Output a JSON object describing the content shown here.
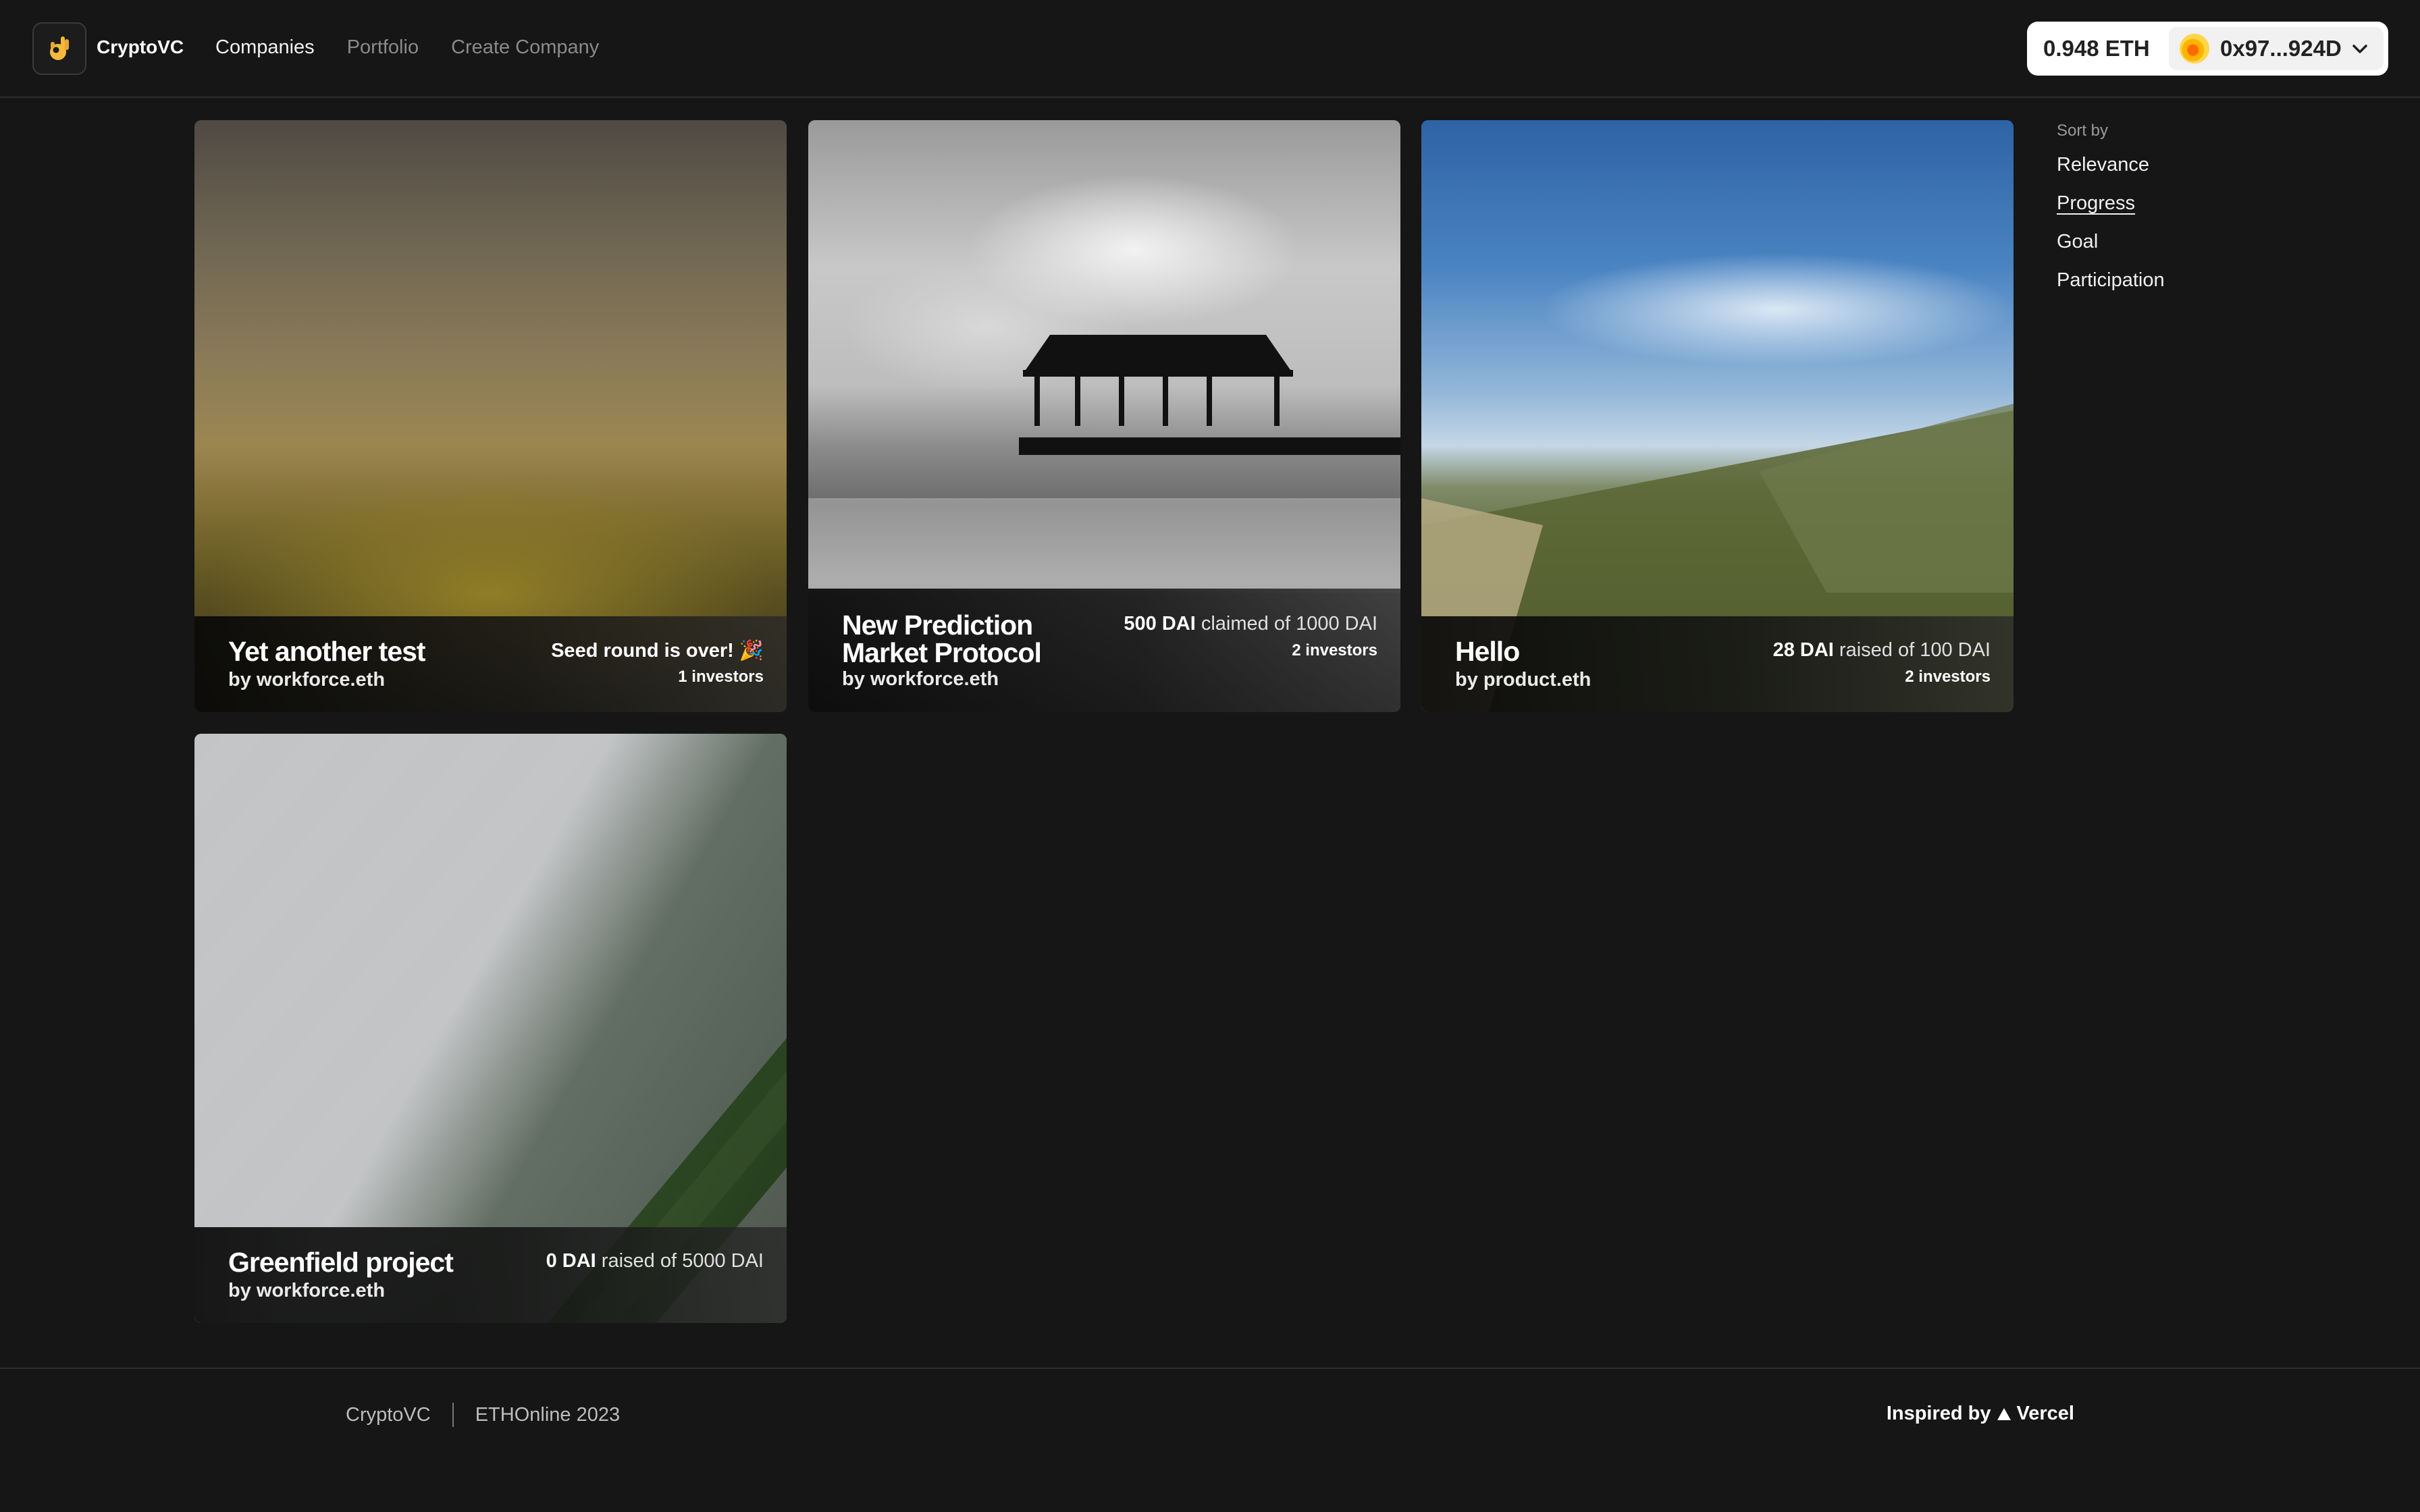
{
  "header": {
    "brand": "CryptoVC",
    "nav": [
      {
        "label": "Companies",
        "active": true
      },
      {
        "label": "Portfolio",
        "active": false
      },
      {
        "label": "Create Company",
        "active": false
      }
    ],
    "wallet": {
      "balance": "0.948 ETH",
      "address": "0x97...924D",
      "avatar_icon": "user-avatar-icon"
    },
    "logo_icon": "ok-hand-icon"
  },
  "cards": [
    {
      "title": "Yet another test",
      "by": "by workforce.eth",
      "stat_main": "Seed round is over! 🎉",
      "stat_rest": "",
      "investors": "1 investors",
      "image": "hill"
    },
    {
      "title": "New Prediction Market Protocol",
      "by": "by workforce.eth",
      "stat_main": "500 DAI",
      "stat_rest": " claimed of 1000 DAI",
      "investors": "2 investors",
      "image": "pier"
    },
    {
      "title": "Hello",
      "by": "by product.eth",
      "stat_main": "28 DAI",
      "stat_rest": " raised of 100 DAI",
      "investors": "2 investors",
      "image": "sky"
    },
    {
      "title": "Greenfield project",
      "by": "by workforce.eth",
      "stat_main": "0 DAI",
      "stat_rest": " raised of 5000 DAI",
      "investors": "",
      "image": "field"
    }
  ],
  "sort": {
    "label": "Sort by",
    "options": [
      {
        "label": "Relevance",
        "active": false
      },
      {
        "label": "Progress",
        "active": true
      },
      {
        "label": "Goal",
        "active": false
      },
      {
        "label": "Participation",
        "active": false
      }
    ]
  },
  "footer": {
    "brand": "CryptoVC",
    "event": "ETHOnline 2023",
    "inspired_prefix": "Inspired by",
    "inspired_name": "Vercel",
    "inspired_icon": "vercel-triangle-icon"
  }
}
